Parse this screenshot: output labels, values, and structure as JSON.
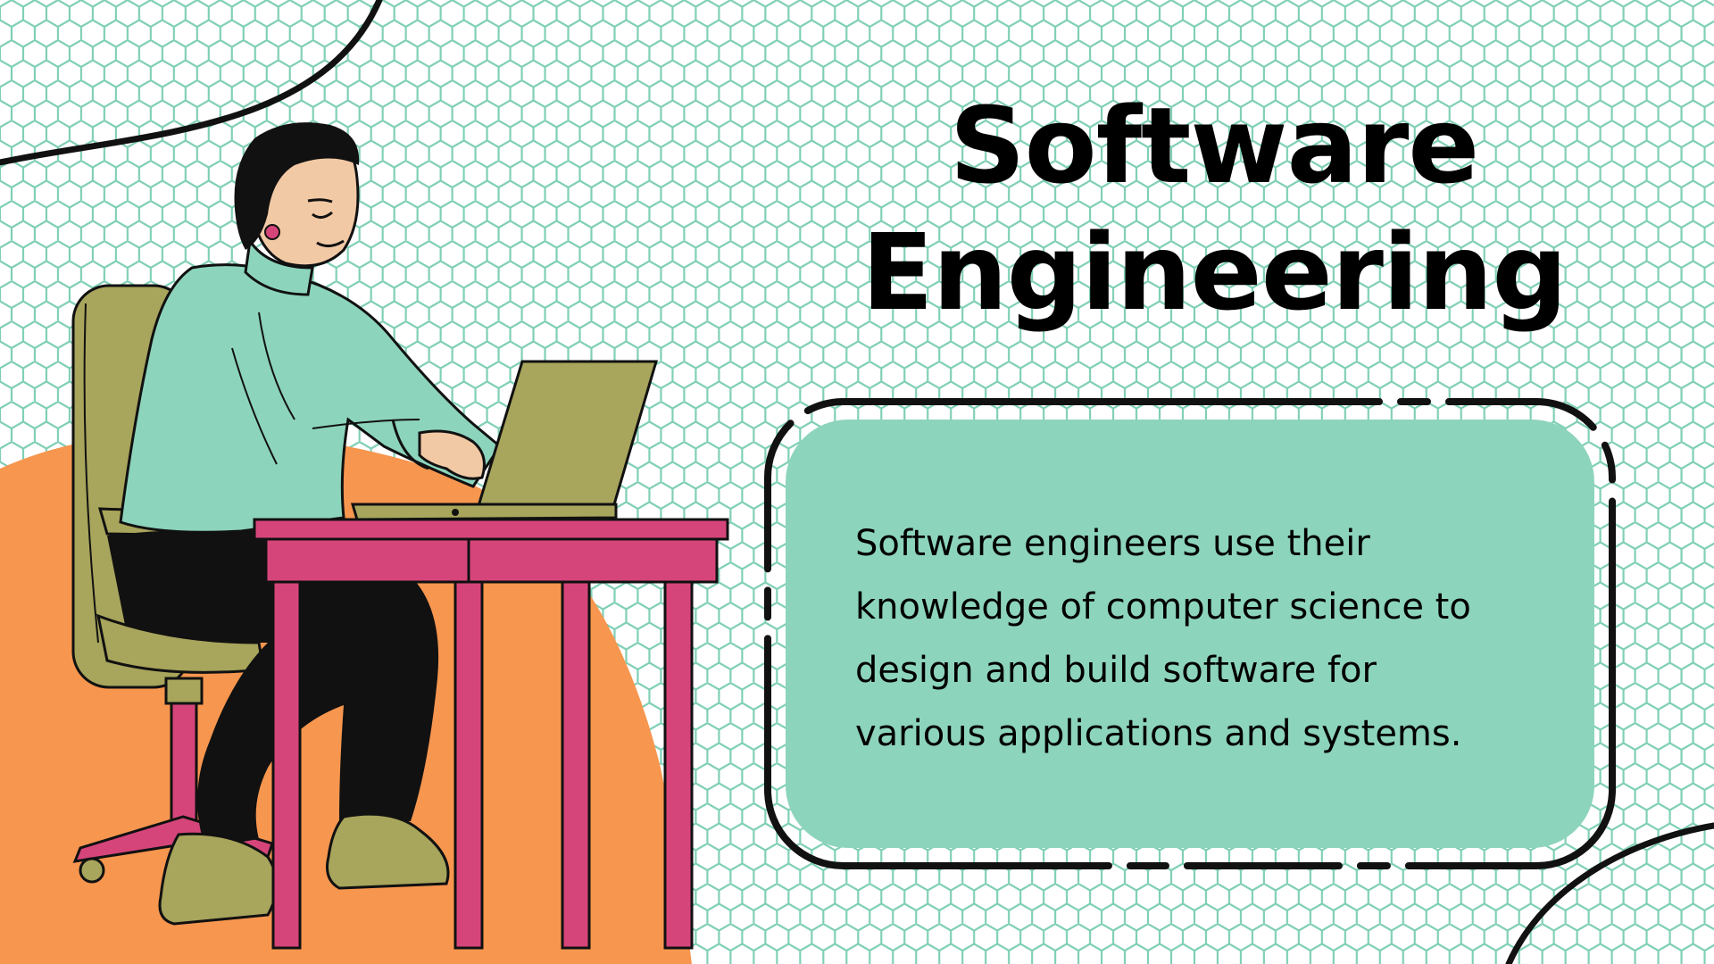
{
  "slide": {
    "title_line1": "Software",
    "title_line2": "Engineering",
    "body_lines": [
      "Software engineers use their",
      "knowledge of computer science to",
      "design and build software for",
      "various applications and systems."
    ]
  },
  "colors": {
    "background": "#ffffff",
    "hex_pattern": "#7fcfb6",
    "card_fill": "#8dd4bd",
    "orange_blob": "#f7964f",
    "desk_pink": "#d6457a",
    "chair_olive": "#a8a55c",
    "sweater_mint": "#8dd4bd",
    "outline": "#111111"
  },
  "icons": [
    "person-at-laptop-illustration",
    "desk-illustration",
    "office-chair-illustration",
    "laptop-illustration"
  ]
}
